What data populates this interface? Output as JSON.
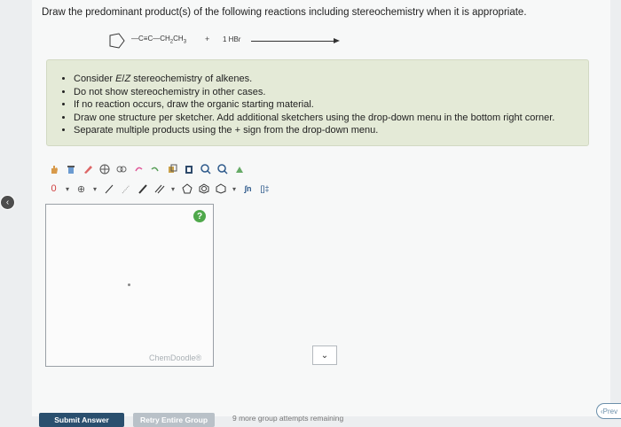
{
  "question": {
    "text": "Draw the predominant product(s) of the following reactions including stereochemistry when it is appropriate."
  },
  "reaction": {
    "reactant_prefix": "—C≡C—CH",
    "reactant_sub1": "2",
    "reactant_mid": "CH",
    "reactant_sub2": "3",
    "plus": "+",
    "reagent": "1 HBr"
  },
  "instructions": [
    "Consider E/Z stereochemistry of alkenes.",
    "Do not show stereochemistry in other cases.",
    "If no reaction occurs, draw the organic starting material.",
    "Draw one structure per sketcher. Add additional sketchers using the drop-down menu in the bottom right corner.",
    "Separate multiple products using the + sign from the drop-down menu."
  ],
  "sketcher": {
    "help_symbol": "?",
    "watermark": "ChemDoodle®",
    "toolbar_row2_text": "0",
    "formula_tool": "∫n",
    "bracket_tool": "[]‡"
  },
  "dropdown": {
    "symbol": "⌄"
  },
  "buttons": {
    "submit": "Submit Answer",
    "retry": "Retry Entire Group",
    "prev": "Prev"
  },
  "attempts": "9 more group attempts remaining",
  "icons": {
    "toolbar_row1": [
      "hand-icon",
      "clear-icon",
      "eraser-icon",
      "center-icon",
      "scale-icon",
      "undo-icon",
      "redo-icon",
      "copy-icon",
      "paste-icon",
      "zoom-in-icon",
      "zoom-out-icon",
      "clean-icon"
    ],
    "toolbar_row2": [
      "charge-icon",
      "charge-dropdown-icon",
      "add-atom-icon",
      "atom-dropdown-icon",
      "single-bond-icon",
      "stereo-bond-icon",
      "double-bond-icon",
      "triple-bond-icon",
      "bond-dropdown-icon",
      "cyclopentane-icon",
      "benzene-icon",
      "cyclohexane-icon",
      "ring-dropdown-icon"
    ]
  }
}
